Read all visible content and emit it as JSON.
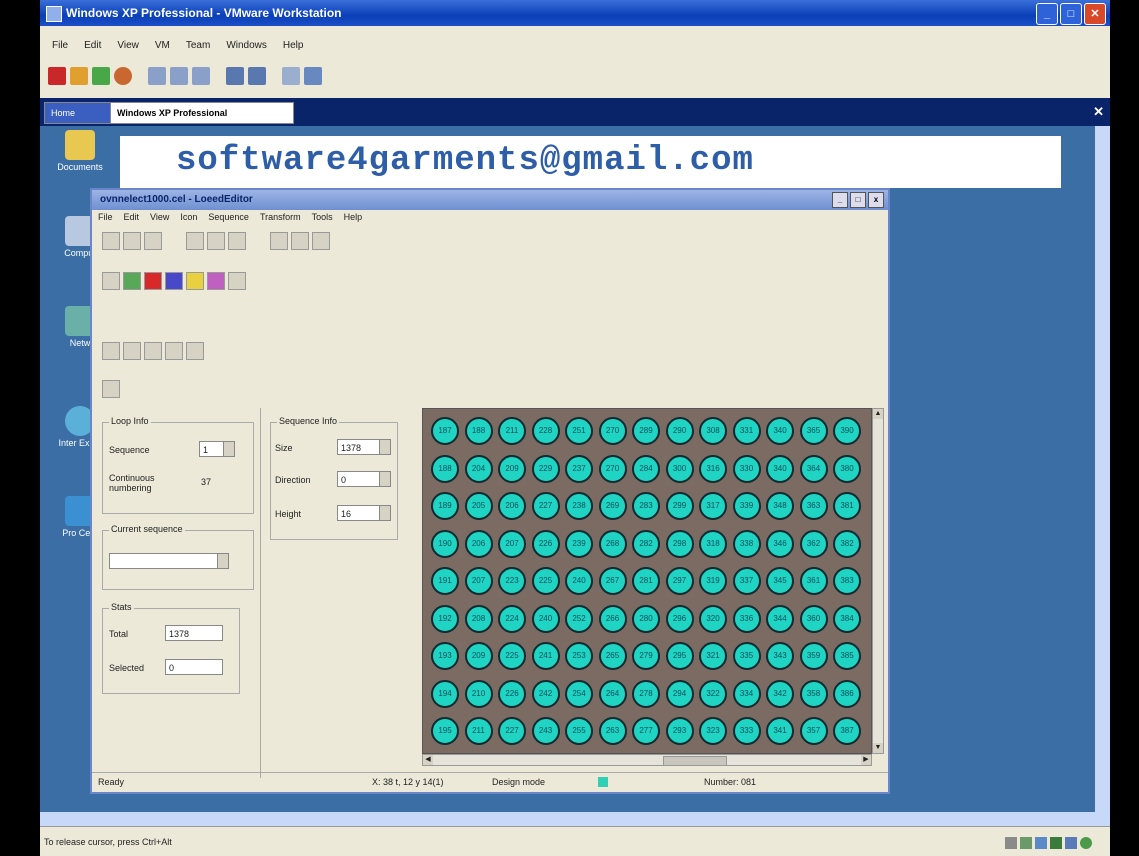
{
  "window": {
    "title": "Windows XP Professional - VMware Workstation"
  },
  "menubar": [
    "File",
    "Edit",
    "View",
    "VM",
    "Team",
    "Windows",
    "Help"
  ],
  "toolbar_icons": [
    "power-off-icon",
    "pause-icon",
    "play-icon",
    "reset-icon",
    "snapshot-icon",
    "revert-icon",
    "snapshot-manager-icon",
    "fullscreen-icon",
    "quick-switch-icon",
    "summary-view-icon",
    "console-view-icon"
  ],
  "tabs": [
    {
      "label": "Home"
    },
    {
      "label": "Windows XP Professional"
    }
  ],
  "desktop_icons": [
    {
      "label": "Documents"
    },
    {
      "label": "Comput"
    },
    {
      "label": "Netw"
    },
    {
      "label": "Inter Explo"
    },
    {
      "label": "Pro Cent"
    }
  ],
  "banner": {
    "text": "software4garments@gmail.com"
  },
  "led_window": {
    "title": "ovnnelect1000.cel - LoeedEditor",
    "menu": [
      "File",
      "Edit",
      "View",
      "Icon",
      "Sequence",
      "Transform",
      "Tools",
      "Help"
    ],
    "loop_info": {
      "legend": "Loop Info",
      "sequence_label": "Sequence",
      "sequence_value": "1",
      "continuous_label": "Continuous numbering",
      "continuous_value": "37"
    },
    "current_sequence": {
      "legend": "Current sequence",
      "value": ""
    },
    "stats": {
      "legend": "Stats",
      "total_label": "Total",
      "total_value": "1378",
      "selected_label": "Selected",
      "selected_value": "0"
    },
    "sequence_info": {
      "legend": "Sequence Info",
      "size_label": "Size",
      "size_value": "1378",
      "direction_label": "Direction",
      "direction_value": "0",
      "height_label": "Height",
      "height_value": "16"
    },
    "status": {
      "ready": "Ready",
      "coords": "X: 38 t, 12 y 14(1)",
      "mode": "Design mode",
      "number": "Number: 081"
    },
    "led_rows": [
      [
        "187",
        "188",
        "211",
        "228",
        "251",
        "270",
        "289",
        "290",
        "308",
        "331",
        "340",
        "365",
        "390"
      ],
      [
        "188",
        "204",
        "209",
        "229",
        "237",
        "270",
        "284",
        "300",
        "316",
        "330",
        "340",
        "364",
        "380"
      ],
      [
        "189",
        "205",
        "206",
        "227",
        "238",
        "269",
        "283",
        "299",
        "317",
        "339",
        "348",
        "363",
        "381"
      ],
      [
        "190",
        "206",
        "207",
        "226",
        "239",
        "268",
        "282",
        "298",
        "318",
        "338",
        "346",
        "362",
        "382"
      ],
      [
        "191",
        "207",
        "223",
        "225",
        "240",
        "267",
        "281",
        "297",
        "319",
        "337",
        "345",
        "361",
        "383"
      ],
      [
        "192",
        "208",
        "224",
        "240",
        "252",
        "266",
        "280",
        "296",
        "320",
        "336",
        "344",
        "360",
        "384"
      ],
      [
        "193",
        "209",
        "225",
        "241",
        "253",
        "265",
        "279",
        "295",
        "321",
        "335",
        "343",
        "359",
        "385"
      ],
      [
        "194",
        "210",
        "226",
        "242",
        "254",
        "264",
        "278",
        "294",
        "322",
        "334",
        "342",
        "358",
        "386"
      ],
      [
        "195",
        "211",
        "227",
        "243",
        "255",
        "263",
        "277",
        "293",
        "323",
        "333",
        "341",
        "357",
        "387"
      ]
    ]
  },
  "statusbar": {
    "text": "To release cursor, press Ctrl+Alt"
  },
  "colors": {
    "led_fill": "#1fd4c2",
    "canvas_bg": "#7b6b62",
    "titlebar": "#0a3fb8",
    "desktop": "#3a6ea5",
    "banner_text": "#2f5ea8"
  }
}
